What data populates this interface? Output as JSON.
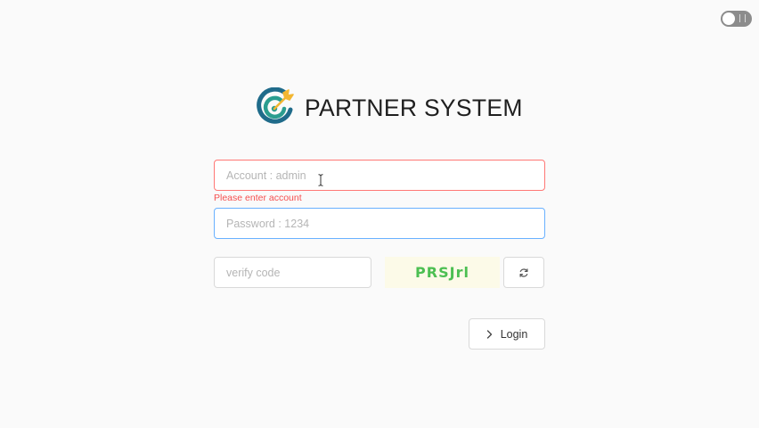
{
  "app": {
    "brand": "PARTNER SYSTEM"
  },
  "login_form": {
    "account": {
      "value": "",
      "placeholder": "Account : admin",
      "error": "Please enter account"
    },
    "password": {
      "value": "",
      "placeholder": "Password : 1234"
    },
    "verify": {
      "value": "",
      "placeholder": "verify code"
    },
    "captcha_text": "PRSJrl",
    "login_label": "Login"
  },
  "icons": {
    "logo": "target-logo-icon",
    "refresh": "refresh-icon",
    "login": "chevron-right-icon",
    "toggle": "theme-toggle-switch"
  },
  "colors": {
    "error": "#f5504f",
    "focus": "#69b1ff",
    "captcha": "#4cbf52",
    "logo_teal": "#2a9d8f",
    "logo_blue": "#1f6b8a",
    "logo_gold": "#f2b632"
  }
}
